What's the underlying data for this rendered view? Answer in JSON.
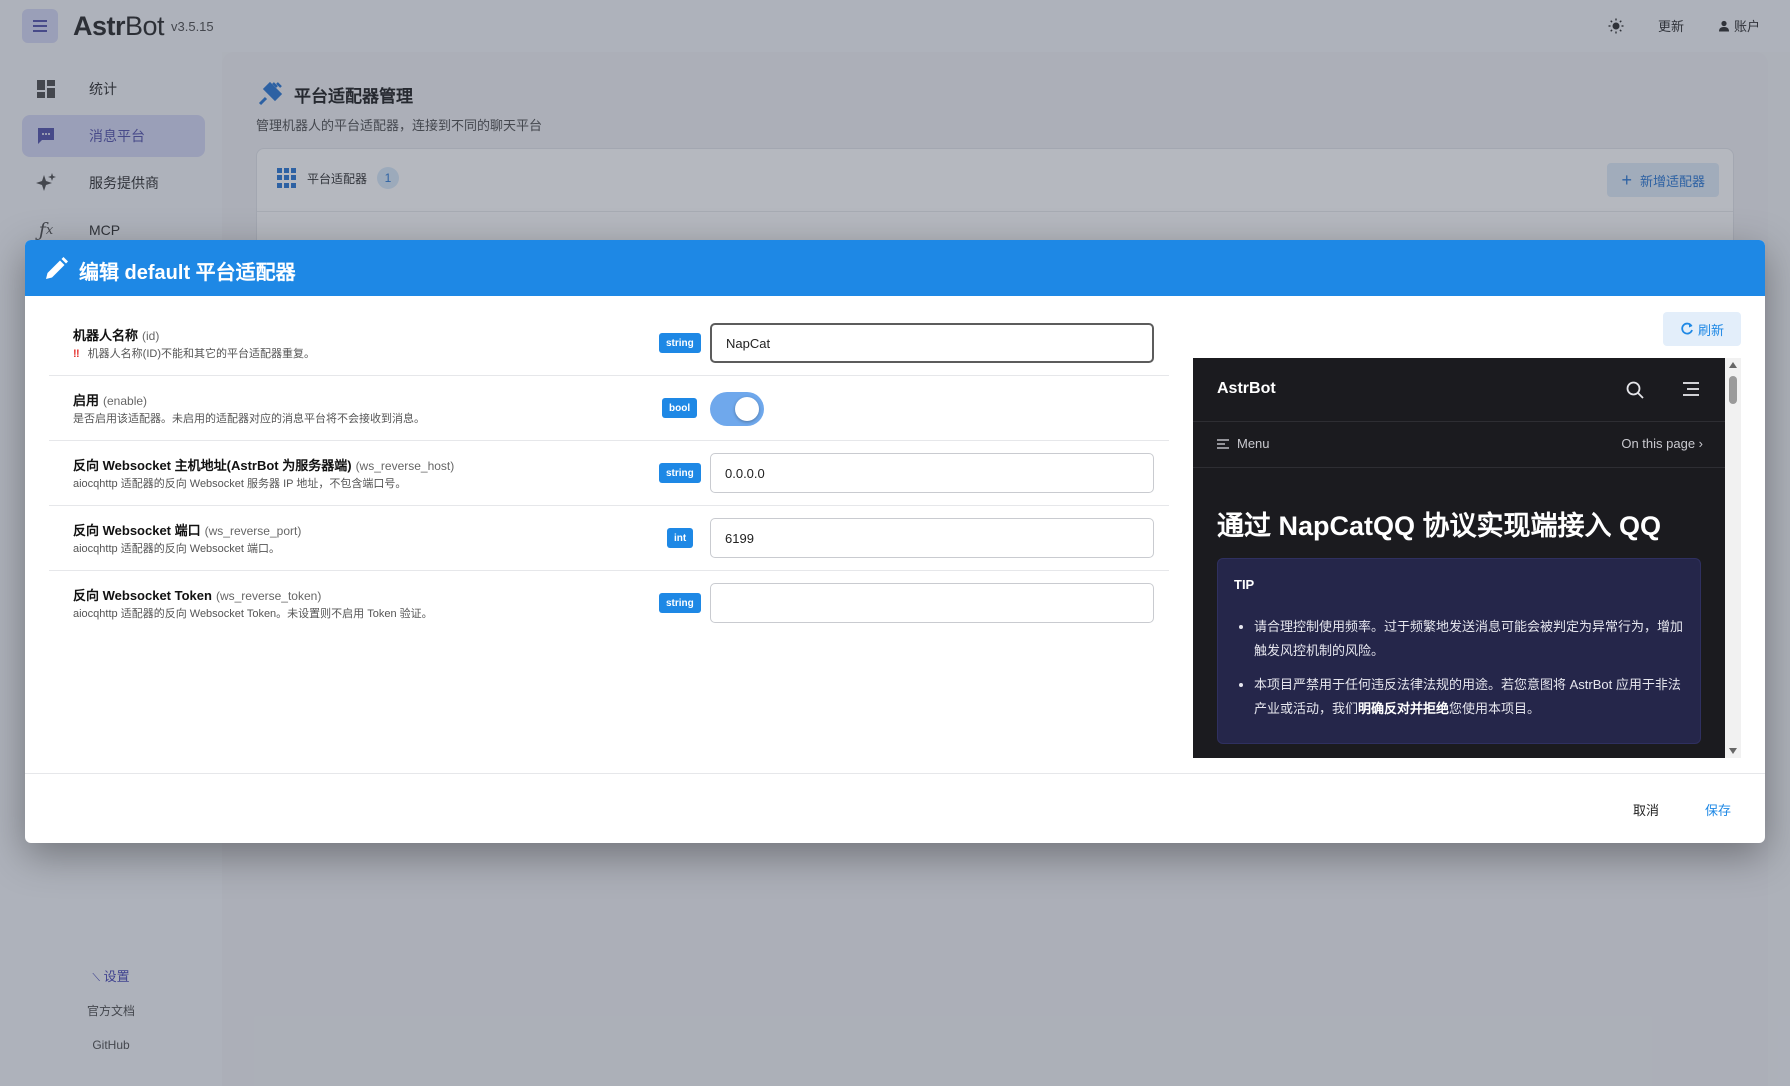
{
  "app": {
    "brand_prefix": "Astr",
    "brand_suffix": "Bot",
    "version": "v3.5.15",
    "theme_icon": "sun-icon",
    "update_label": "更新",
    "account_label": "账户"
  },
  "sidebar": {
    "items": [
      {
        "label": "统计",
        "icon": "dashboard-icon"
      },
      {
        "label": "消息平台",
        "icon": "chat-icon",
        "active": true
      },
      {
        "label": "服务提供商",
        "icon": "sparkle-icon"
      },
      {
        "label": "MCP",
        "icon": "function-icon"
      }
    ],
    "settings_label": "设置",
    "docs_label": "官方文档",
    "github_label": "GitHub"
  },
  "page": {
    "title": "平台适配器管理",
    "subtitle": "管理机器人的平台适配器，连接到不同的聊天平台",
    "card_title": "平台适配器",
    "card_count": "1",
    "add_button": "新增适配器"
  },
  "dialog": {
    "title": "编辑 default 平台适配器",
    "fields": [
      {
        "label": "机器人名称",
        "key": "(id)",
        "desc": "机器人名称(ID)不能和其它的平台适配器重复。",
        "warn": "‼",
        "type": "string",
        "value": "NapCat"
      },
      {
        "label": "启用",
        "key": "(enable)",
        "desc": "是否启用该适配器。未启用的适配器对应的消息平台将不会接收到消息。",
        "type": "bool",
        "value": "true"
      },
      {
        "label": "反向 Websocket 主机地址(AstrBot 为服务器端)",
        "key": "(ws_reverse_host)",
        "desc": "aiocqhttp 适配器的反向 Websocket 服务器 IP 地址，不包含端口号。",
        "type": "string",
        "value": "0.0.0.0"
      },
      {
        "label": "反向 Websocket 端口",
        "key": "(ws_reverse_port)",
        "desc": "aiocqhttp 适配器的反向 Websocket 端口。",
        "type": "int",
        "value": "6199"
      },
      {
        "label": "反向 Websocket Token",
        "key": "(ws_reverse_token)",
        "desc": "aiocqhttp 适配器的反向 Websocket Token。未设置则不启用 Token 验证。",
        "type": "string",
        "value": ""
      }
    ],
    "refresh_label": "刷新",
    "cancel_label": "取消",
    "save_label": "保存"
  },
  "preview": {
    "brand": "AstrBot",
    "menu_label": "Menu",
    "on_this_page": "On this page ›",
    "heading": "通过 NapCatQQ 协议实现端接入 QQ",
    "tip_title": "TIP",
    "tip_item_1": "请合理控制使用频率。过于频繁地发送消息可能会被判定为异常行为，增加触发风控机制的风险。",
    "tip_item_2_pre": "本项目严禁用于任何违反法律法规的用途。若您意图将 AstrBot 应用于非法产业或活动，我们",
    "tip_item_2_bold": "明确反对并拒绝",
    "tip_item_2_post": "您使用本项目。"
  },
  "colors": {
    "primary": "#1e88e5",
    "sidebar_active": "#d3d5f3",
    "preview_bg": "#1b1b1f",
    "tip_bg": "#25264a"
  }
}
